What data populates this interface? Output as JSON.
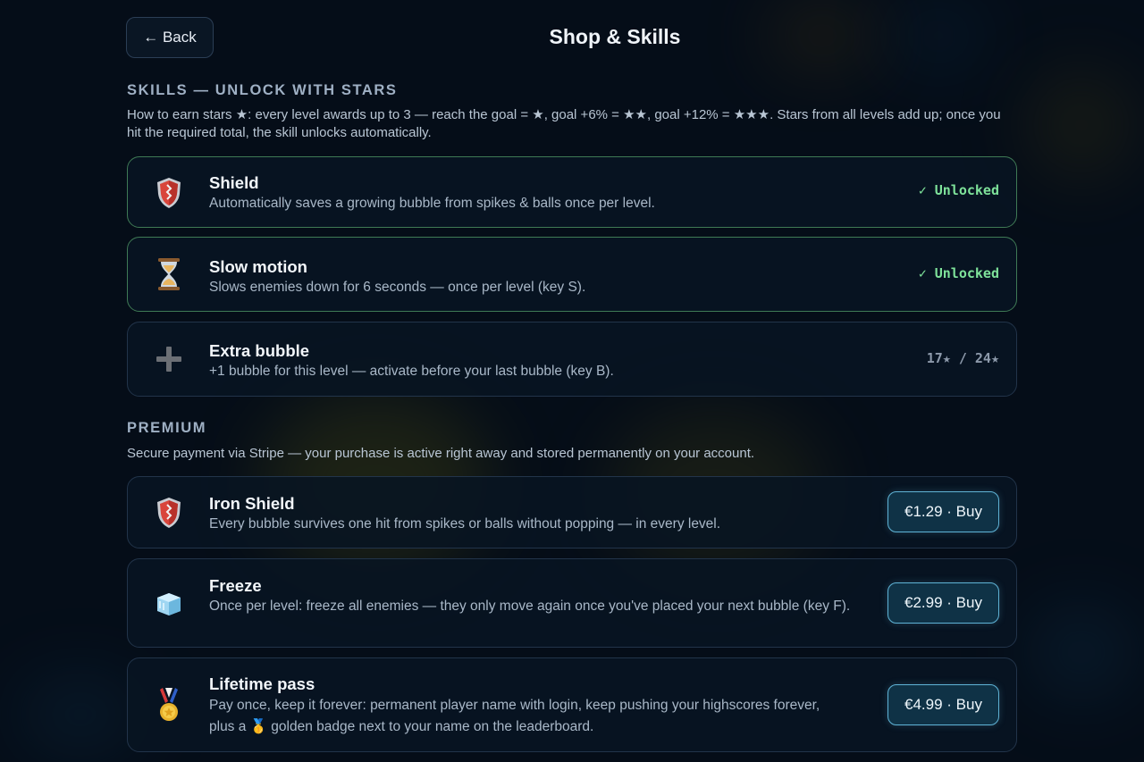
{
  "header": {
    "back_label": "← Back",
    "title": "Shop & Skills"
  },
  "skills": {
    "heading": "SKILLS — UNLOCK WITH STARS",
    "description": "How to earn stars ★: every level awards up to 3 — reach the goal = ★, goal +6% = ★★, goal +12% = ★★★. Stars from all levels add up; once you hit the required total, the skill unlocks automatically.",
    "items": [
      {
        "icon": "shield-icon",
        "title": "Shield",
        "description": "Automatically saves a growing bubble from spikes & balls once per level.",
        "status": "✓ Unlocked"
      },
      {
        "icon": "hourglass-icon",
        "title": "Slow motion",
        "description": "Slows enemies down for 6 seconds — once per level (key S).",
        "status": "✓ Unlocked"
      },
      {
        "icon": "plus-icon",
        "title": "Extra bubble",
        "description": "+1 bubble for this level — activate before your last bubble (key B).",
        "status": "17★ / 24★"
      }
    ]
  },
  "premium": {
    "heading": "PREMIUM",
    "description": "Secure payment via Stripe — your purchase is active right away and stored permanently on your account.",
    "items": [
      {
        "icon": "iron-shield-icon",
        "title": "Iron Shield",
        "description": "Every bubble survives one hit from spikes or balls without popping — in every level.",
        "buy_label": "€1.29 · Buy"
      },
      {
        "icon": "ice-cube-icon",
        "title": "Freeze",
        "description": "Once per level: freeze all enemies — they only move again once you've placed your next bubble (key F).",
        "buy_label": "€2.99 · Buy"
      },
      {
        "icon": "medal-icon",
        "title": "Lifetime pass",
        "description": "Pay once, keep it forever: permanent player name with login, keep pushing your highscores forever, plus a 🥇 golden badge next to your name on the leaderboard.",
        "buy_label": "€4.99 · Buy"
      }
    ]
  },
  "colors": {
    "background": "#050d18",
    "card_border_unlocked": "#3f7a55",
    "unlocked_text": "#7ee29a",
    "buy_border": "#5fb3d6"
  }
}
